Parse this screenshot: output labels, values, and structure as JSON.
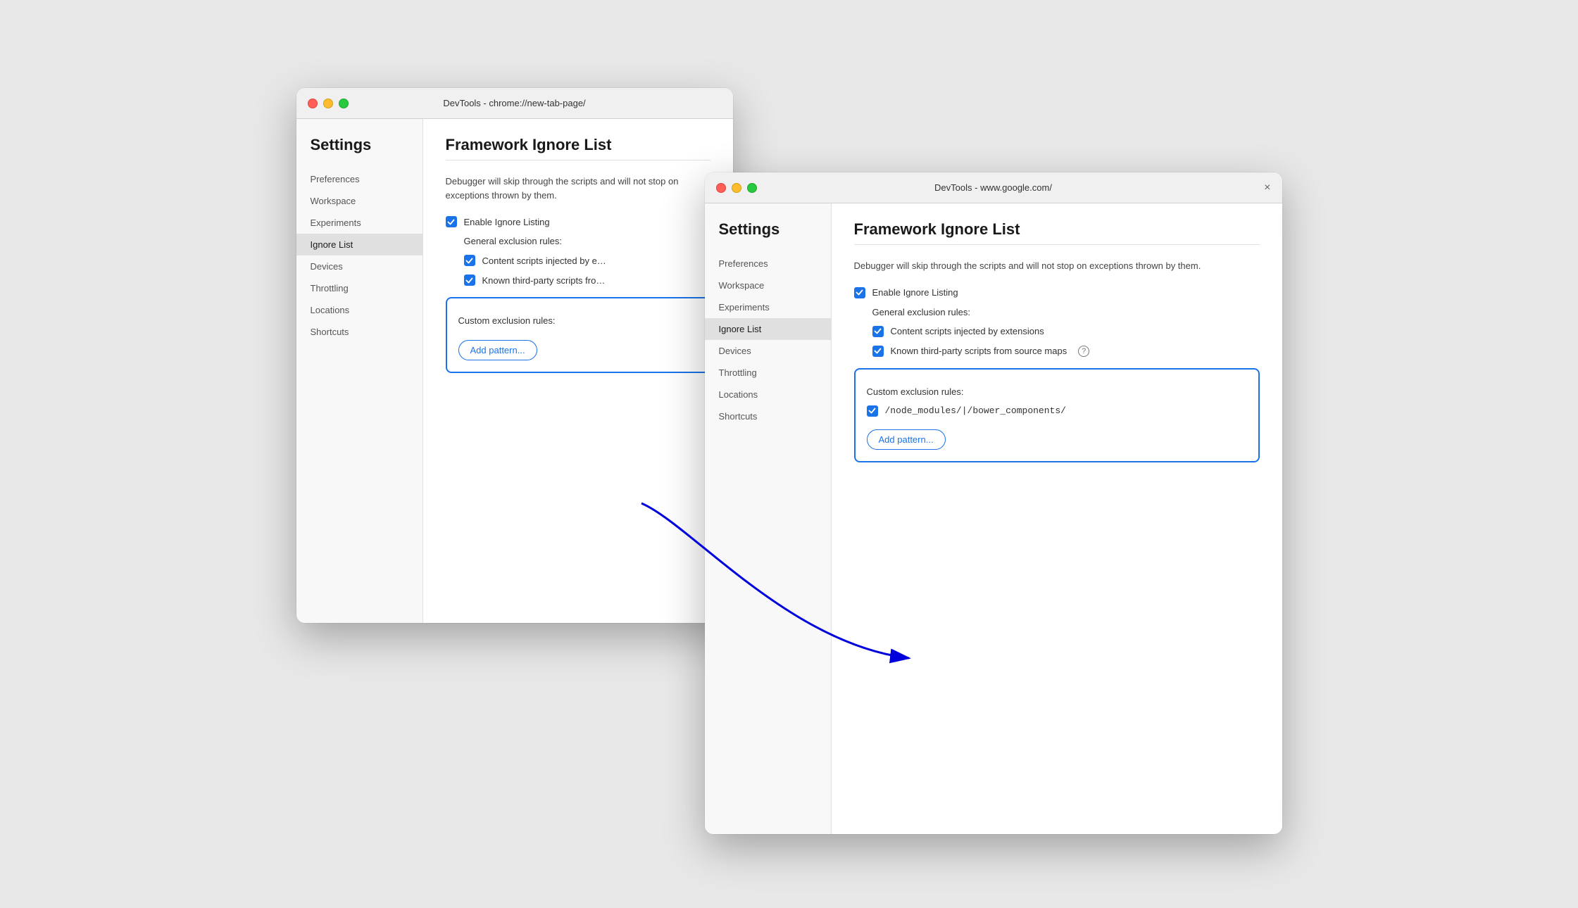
{
  "window_back": {
    "titlebar": {
      "title": "DevTools - chrome://new-tab-page/",
      "close_label": "×"
    },
    "sidebar": {
      "heading": "Settings",
      "items": [
        {
          "label": "Preferences",
          "active": false
        },
        {
          "label": "Workspace",
          "active": false
        },
        {
          "label": "Experiments",
          "active": false
        },
        {
          "label": "Ignore List",
          "active": true
        },
        {
          "label": "Devices",
          "active": false
        },
        {
          "label": "Throttling",
          "active": false
        },
        {
          "label": "Locations",
          "active": false
        },
        {
          "label": "Shortcuts",
          "active": false
        }
      ]
    },
    "content": {
      "title": "Framework Ignore List",
      "description": "Debugger will skip through the scripts and will not stop on exceptions thrown by them.",
      "enable_ignore_listing_label": "Enable Ignore Listing",
      "general_exclusion_label": "General exclusion rules:",
      "rule1_label": "Content scripts injected by e…",
      "rule2_label": "Known third-party scripts fro…",
      "custom_exclusion_label": "Custom exclusion rules:",
      "add_pattern_label": "Add pattern..."
    }
  },
  "window_front": {
    "titlebar": {
      "title": "DevTools - www.google.com/",
      "close_label": "×"
    },
    "sidebar": {
      "heading": "Settings",
      "items": [
        {
          "label": "Preferences",
          "active": false
        },
        {
          "label": "Workspace",
          "active": false
        },
        {
          "label": "Experiments",
          "active": false
        },
        {
          "label": "Ignore List",
          "active": true
        },
        {
          "label": "Devices",
          "active": false
        },
        {
          "label": "Throttling",
          "active": false
        },
        {
          "label": "Locations",
          "active": false
        },
        {
          "label": "Shortcuts",
          "active": false
        }
      ]
    },
    "content": {
      "title": "Framework Ignore List",
      "description": "Debugger will skip through the scripts and will not stop on exceptions thrown by them.",
      "enable_ignore_listing_label": "Enable Ignore Listing",
      "general_exclusion_label": "General exclusion rules:",
      "rule1_label": "Content scripts injected by extensions",
      "rule2_label": "Known third-party scripts from source maps",
      "custom_exclusion_label": "Custom exclusion rules:",
      "pattern_entry": "/node_modules/|/bower_components/",
      "add_pattern_label": "Add pattern..."
    }
  },
  "arrow": {
    "color": "#0000ee"
  }
}
